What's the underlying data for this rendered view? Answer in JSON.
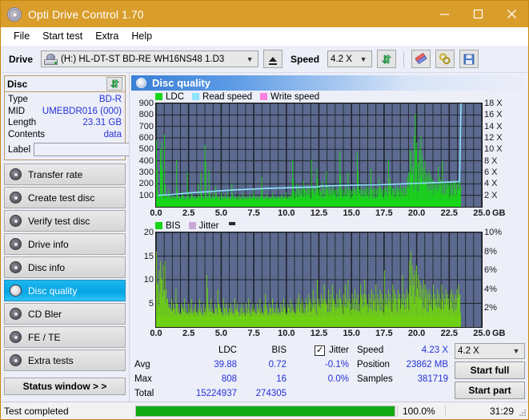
{
  "window": {
    "title": "Opti Drive Control 1.70",
    "icon": "disc-icon",
    "minimize_label": "─",
    "maximize_label": "☐",
    "close_label": "✕"
  },
  "menu": {
    "items": [
      "File",
      "Start test",
      "Extra",
      "Help"
    ]
  },
  "toolbar": {
    "drive_label": "Drive",
    "drive_value": "(H:)  HL-DT-ST BD-RE  WH16NS48 1.D3",
    "eject_icon": "eject-icon",
    "speed_label": "Speed",
    "speed_value": "4.2 X",
    "refresh_icon": "refresh-icon",
    "erase_icon": "eraser-icon",
    "bookmark_icon": "bookmark-icon",
    "save_icon": "save-icon"
  },
  "disc_panel": {
    "title": "Disc",
    "refresh_icon": "refresh-icon",
    "rows": [
      {
        "key": "Type",
        "value": "BD-R"
      },
      {
        "key": "MID",
        "value": "UMEBDR016 (000)"
      },
      {
        "key": "Length",
        "value": "23.31 GB"
      },
      {
        "key": "Contents",
        "value": "data"
      }
    ],
    "label_key": "Label",
    "label_value": "",
    "label_placeholder": "",
    "disc_button_icon": "cd-icon"
  },
  "sidebar": {
    "items": [
      {
        "label": "Transfer rate",
        "icon": "disc-icon",
        "active": false
      },
      {
        "label": "Create test disc",
        "icon": "disc-icon",
        "active": false
      },
      {
        "label": "Verify test disc",
        "icon": "disc-icon",
        "active": false
      },
      {
        "label": "Drive info",
        "icon": "disc-icon",
        "active": false
      },
      {
        "label": "Disc info",
        "icon": "disc-icon",
        "active": false
      },
      {
        "label": "Disc quality",
        "icon": "disc-icon",
        "active": true
      },
      {
        "label": "CD Bler",
        "icon": "disc-icon",
        "active": false
      },
      {
        "label": "FE / TE",
        "icon": "disc-icon",
        "active": false
      },
      {
        "label": "Extra tests",
        "icon": "disc-icon",
        "active": false
      }
    ],
    "status_window_label": "Status window > >"
  },
  "panel": {
    "title": "Disc quality",
    "icon": "disc-quality-icon"
  },
  "colors": {
    "ldc_green": "#19d619",
    "bis_green": "#6fd114",
    "read_speed": "#8fe3ff",
    "write_speed": "#ff7fe0",
    "jitter": "#c9a8d8",
    "plot_bg": "#5b6a8e",
    "grid": "#20242e",
    "accent_blue": "#2432d6",
    "title_bar": "#d99d2b",
    "progress_green": "#11ab11"
  },
  "chart_data": [
    {
      "type": "area",
      "id": "ldc-chart",
      "title": "Disc quality",
      "xlabel": "GB",
      "ylabel": "LDC",
      "xlim": [
        0.0,
        25.0
      ],
      "ylim": [
        0,
        900
      ],
      "y2lim": [
        0,
        18
      ],
      "y2label": "X",
      "grid": true,
      "legend_position": "top-left",
      "legend": [
        {
          "name": "LDC",
          "color": "#19d619"
        },
        {
          "name": "Read speed",
          "color": "#8fe3ff"
        },
        {
          "name": "Write speed",
          "color": "#ff7fe0"
        }
      ],
      "xticks": [
        "0.0",
        "2.5",
        "5.0",
        "7.5",
        "10.0",
        "12.5",
        "15.0",
        "17.5",
        "20.0",
        "22.5",
        "25.0"
      ],
      "xunit": "GB",
      "yticks": [
        100,
        200,
        300,
        400,
        500,
        600,
        700,
        800,
        900
      ],
      "y2ticks": [
        "2 X",
        "4 X",
        "6 X",
        "8 X",
        "10 X",
        "12 X",
        "14 X",
        "16 X",
        "18 X"
      ],
      "series": [
        {
          "name": "LDC",
          "color": "#19d619",
          "kind": "spikes",
          "x_end": 23.4,
          "baseline": 55,
          "values": [
            580,
            130,
            95,
            500,
            560,
            95,
            630,
            110,
            90,
            150,
            80,
            95,
            110,
            85,
            90,
            410,
            100,
            85,
            90,
            130,
            95,
            80,
            90,
            300,
            85,
            90,
            130,
            80,
            95,
            90,
            85,
            200,
            90,
            300,
            95,
            80,
            540,
            100,
            85,
            320,
            90,
            80,
            120,
            85,
            180,
            90,
            80,
            95,
            130,
            85,
            90,
            110,
            80,
            150,
            85,
            90,
            200,
            80,
            95,
            90,
            85,
            100,
            95,
            80,
            120,
            85,
            90,
            95,
            80,
            110,
            85,
            90,
            150,
            80,
            95,
            85,
            90,
            100,
            260,
            90,
            85,
            95,
            110,
            80,
            90,
            85,
            120,
            95,
            90,
            80,
            100,
            85,
            90,
            110,
            80,
            95,
            130,
            85,
            90,
            100,
            120,
            410,
            140,
            130,
            200,
            150,
            180,
            140,
            160,
            230,
            150,
            140,
            190,
            170,
            150,
            410,
            160,
            140,
            180,
            330,
            150,
            170,
            140,
            220,
            160,
            150,
            310,
            140,
            170,
            160,
            150,
            180,
            140,
            160,
            150,
            170,
            480,
            150,
            160,
            140,
            170,
            150,
            300,
            160,
            150,
            140,
            170,
            160,
            150,
            470,
            160,
            150,
            170,
            140,
            160,
            150,
            180,
            170,
            150,
            330,
            160,
            150,
            170,
            160,
            150,
            250,
            170,
            160,
            150,
            180,
            160,
            170,
            410,
            250,
            180,
            160,
            170,
            150,
            180,
            170,
            160,
            190,
            170,
            160,
            180,
            170,
            260,
            300,
            500,
            480,
            350,
            620,
            810,
            560,
            380,
            500,
            620,
            450,
            340,
            400,
            300,
            260,
            320,
            280,
            250,
            230,
            220,
            210,
            200,
            350,
            260,
            230,
            400,
            220,
            210,
            200,
            230,
            220,
            210,
            200,
            230,
            220,
            210,
            200,
            220,
            230
          ]
        },
        {
          "name": "Read speed",
          "color": "#8fe3ff",
          "kind": "line",
          "note": "rising stepped curve from 2.0X to 4.4X, vertical jump to 18X at 23.4 GB",
          "points_x": [
            0.15,
            1.0,
            2.0,
            3.0,
            4.2,
            5.0,
            6.0,
            7.2,
            8.5,
            10.0,
            11.5,
            12.4,
            12.6,
            14.0,
            15.5,
            17.0,
            18.5,
            19.5,
            20.5,
            21.5,
            22.5,
            23.3,
            23.4
          ],
          "points_y": [
            2.0,
            2.1,
            2.3,
            2.5,
            2.65,
            2.8,
            2.95,
            3.05,
            3.2,
            3.3,
            3.4,
            3.45,
            3.6,
            3.7,
            3.8,
            3.85,
            3.95,
            4.05,
            4.1,
            4.2,
            4.3,
            4.4,
            18.0
          ]
        },
        {
          "name": "Write speed",
          "color": "#ff7fe0",
          "kind": "line",
          "points_x": [],
          "points_y": []
        }
      ]
    },
    {
      "type": "area",
      "id": "bis-chart",
      "xlabel": "GB",
      "ylabel": "BIS",
      "xlim": [
        0.0,
        25.0
      ],
      "ylim": [
        0,
        20
      ],
      "y2lim": [
        0,
        10
      ],
      "y2label": "%",
      "grid": true,
      "legend_position": "top-left",
      "legend": [
        {
          "name": "BIS",
          "color": "#19d619"
        },
        {
          "name": "Jitter",
          "color": "#c9a8d8"
        }
      ],
      "xticks": [
        "0.0",
        "2.5",
        "5.0",
        "7.5",
        "10.0",
        "12.5",
        "15.0",
        "17.5",
        "20.0",
        "22.5",
        "25.0"
      ],
      "xunit": "GB",
      "yticks": [
        5,
        10,
        15,
        20
      ],
      "y2ticks": [
        "2%",
        "4%",
        "6%",
        "8%",
        "10%"
      ],
      "series": [
        {
          "name": "BIS",
          "color": "#6fd114",
          "kind": "spikes",
          "x_end": 23.4,
          "baseline": 2.2,
          "values": [
            16,
            9,
            12,
            14,
            10,
            13,
            14,
            8,
            6,
            5,
            4,
            6,
            5,
            4,
            8,
            5,
            4,
            3,
            5,
            4,
            6,
            4,
            3,
            5,
            4,
            6,
            3,
            4,
            5,
            3,
            4,
            6,
            4,
            3,
            5,
            4,
            11,
            5,
            4,
            6,
            4,
            3,
            5,
            4,
            8,
            5,
            4,
            3,
            6,
            4,
            5,
            3,
            4,
            5,
            4,
            3,
            6,
            4,
            5,
            3,
            4,
            5,
            4,
            3,
            5,
            4,
            6,
            3,
            4,
            5,
            4,
            3,
            5,
            4,
            6,
            4,
            3,
            5,
            7,
            4,
            3,
            5,
            4,
            6,
            3,
            4,
            5,
            4,
            3,
            5,
            4,
            6,
            4,
            3,
            5,
            4,
            6,
            5,
            4,
            3,
            5,
            6,
            7,
            5,
            6,
            5,
            4,
            6,
            5,
            7,
            6,
            5,
            8,
            6,
            5,
            10,
            6,
            5,
            7,
            6,
            9,
            6,
            5,
            8,
            6,
            7,
            9,
            6,
            5,
            7,
            6,
            8,
            6,
            5,
            7,
            9,
            6,
            10,
            6,
            5,
            7,
            6,
            8,
            6,
            7,
            5,
            9,
            6,
            7,
            10,
            6,
            5,
            7,
            6,
            8,
            7,
            6,
            9,
            7,
            6,
            8,
            7,
            6,
            12,
            7,
            6,
            8,
            7,
            6,
            9,
            8,
            7,
            6,
            8,
            7,
            6,
            11,
            7,
            6,
            8,
            7,
            14,
            16,
            13,
            11,
            12,
            13,
            11,
            10,
            9,
            8,
            10,
            9,
            8,
            7,
            8,
            7,
            6,
            9,
            7,
            6,
            8,
            7,
            6,
            9,
            7,
            6,
            8,
            7,
            6,
            7,
            8,
            7,
            6,
            7,
            8,
            9,
            7
          ]
        },
        {
          "name": "Jitter",
          "color": "#c9a8d8",
          "kind": "line",
          "points_x": [],
          "points_y": []
        }
      ]
    }
  ],
  "stats": {
    "column_headers": [
      "",
      "LDC",
      "BIS"
    ],
    "rows": [
      {
        "label": "Avg",
        "ldc": "39.88",
        "bis": "0.72",
        "jitter": "-0.1%"
      },
      {
        "label": "Max",
        "ldc": "808",
        "bis": "16",
        "jitter": "0.0%"
      },
      {
        "label": "Total",
        "ldc": "15224937",
        "bis": "274305",
        "jitter": ""
      }
    ],
    "jitter_label": "Jitter",
    "jitter_checked": true,
    "info": [
      {
        "label": "Speed",
        "value": "4.23 X"
      },
      {
        "label": "Position",
        "value": "23862 MB"
      },
      {
        "label": "Samples",
        "value": "381719"
      }
    ],
    "speed_select": "4.2 X",
    "start_full_label": "Start full",
    "start_part_label": "Start part"
  },
  "statusbar": {
    "message": "Test completed",
    "progress_percent": 100.0,
    "progress_text": "100.0%",
    "elapsed": "31:29"
  }
}
